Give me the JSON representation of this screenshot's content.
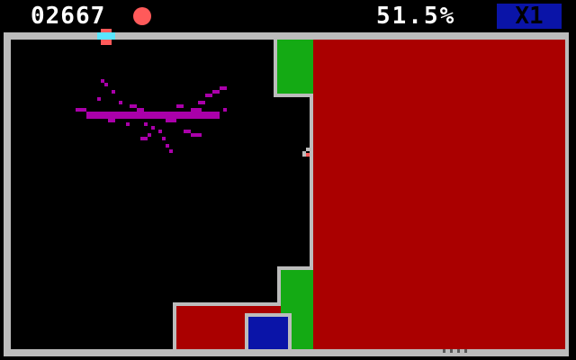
{
  "hud": {
    "score": "02667",
    "lives_icon": "red-circle-icon",
    "claimed_percent": "51.5%",
    "multiplier": "X1"
  },
  "colors": {
    "border": "#bcbcbc",
    "fast_claim": "#aa0000",
    "slow_claim": "#14aa14",
    "bonus_claim": "#0a14a8",
    "qix": "#aa00aa",
    "marker_red": "#ff5a5a",
    "marker_cyan": "#5ae6ff"
  },
  "entities": {
    "player_marker": "diamond-marker-icon",
    "sparx_enemy": "sparx-icon",
    "qix_enemy": "qix-line-creature"
  }
}
